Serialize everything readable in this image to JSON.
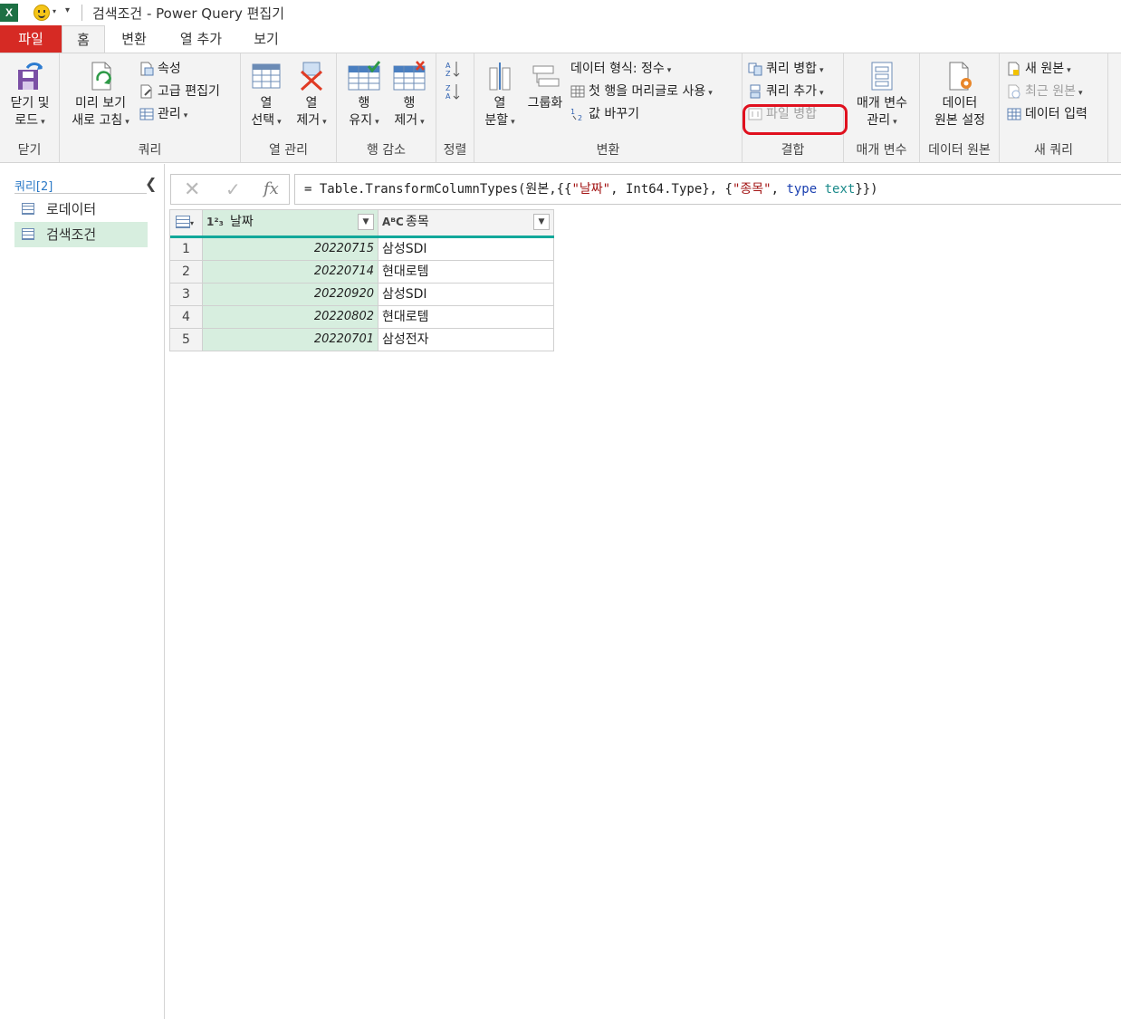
{
  "window": {
    "app_icon_letter": "X",
    "title": "검색조건 - Power Query 편집기"
  },
  "tabs": [
    {
      "label": "파일"
    },
    {
      "label": "홈"
    },
    {
      "label": "변환"
    },
    {
      "label": "열 추가"
    },
    {
      "label": "보기"
    }
  ],
  "ribbon": {
    "close": {
      "line1": "닫기 및",
      "line2": "로드",
      "group": "닫기"
    },
    "query": {
      "refresh_line1": "미리 보기",
      "refresh_line2": "새로 고침",
      "properties": "속성",
      "advanced_editor": "고급 편집기",
      "manage": "관리",
      "group": "쿼리"
    },
    "manage_columns": {
      "choose_line1": "열",
      "choose_line2": "선택",
      "remove_line1": "열",
      "remove_line2": "제거",
      "group": "열 관리"
    },
    "reduce_rows": {
      "keep_line1": "행",
      "keep_line2": "유지",
      "remove_line1": "행",
      "remove_line2": "제거",
      "group": "행 감소"
    },
    "sort": {
      "group": "정렬"
    },
    "transform": {
      "split_line1": "열",
      "split_line2": "분할",
      "group_by": "그룹화",
      "data_type": "데이터 형식: 정수",
      "use_first_row": "첫 행을 머리글로 사용",
      "replace_values": "값 바꾸기",
      "group": "변환"
    },
    "combine": {
      "merge_queries": "쿼리 병합",
      "append_queries": "쿼리 추가",
      "combine_files": "파일 병합",
      "group": "결합"
    },
    "parameters": {
      "line1": "매개 변수",
      "line2": "관리",
      "group": "매개 변수"
    },
    "data_sources": {
      "line1": "데이터",
      "line2": "원본 설정",
      "group": "데이터 원본"
    },
    "new_query": {
      "new_source": "새 원본",
      "recent_sources": "최근 원본",
      "enter_data": "데이터 입력",
      "group": "새 쿼리"
    },
    "highlight_color": "#e0101e"
  },
  "queries_pane": {
    "header": "쿼리[2]",
    "items": [
      {
        "label": "로데이터"
      },
      {
        "label": "검색조건",
        "selected": true
      }
    ]
  },
  "formula_bar": {
    "fx": "fx",
    "prefix": "= Table.TransformColumnTypes(원본,{{",
    "str1": "\"날짜\"",
    "mid1": ", Int64.Type}, {",
    "str2": "\"종목\"",
    "mid2": ", ",
    "kw": "type",
    "mid3": " ",
    "typ": "text",
    "suffix": "}})"
  },
  "grid": {
    "columns": [
      {
        "type_icon": "1²₃",
        "name": "날짜"
      },
      {
        "type_icon": "AᴮC",
        "name": "종목"
      }
    ],
    "rows": [
      {
        "n": "1",
        "date": "20220715",
        "stock": "삼성SDI"
      },
      {
        "n": "2",
        "date": "20220714",
        "stock": "현대로템"
      },
      {
        "n": "3",
        "date": "20220920",
        "stock": "삼성SDI"
      },
      {
        "n": "4",
        "date": "20220802",
        "stock": "현대로템"
      },
      {
        "n": "5",
        "date": "20220701",
        "stock": "삼성전자"
      }
    ],
    "accent_color": "#12a89a",
    "selected_column_color": "#d7eedf"
  }
}
